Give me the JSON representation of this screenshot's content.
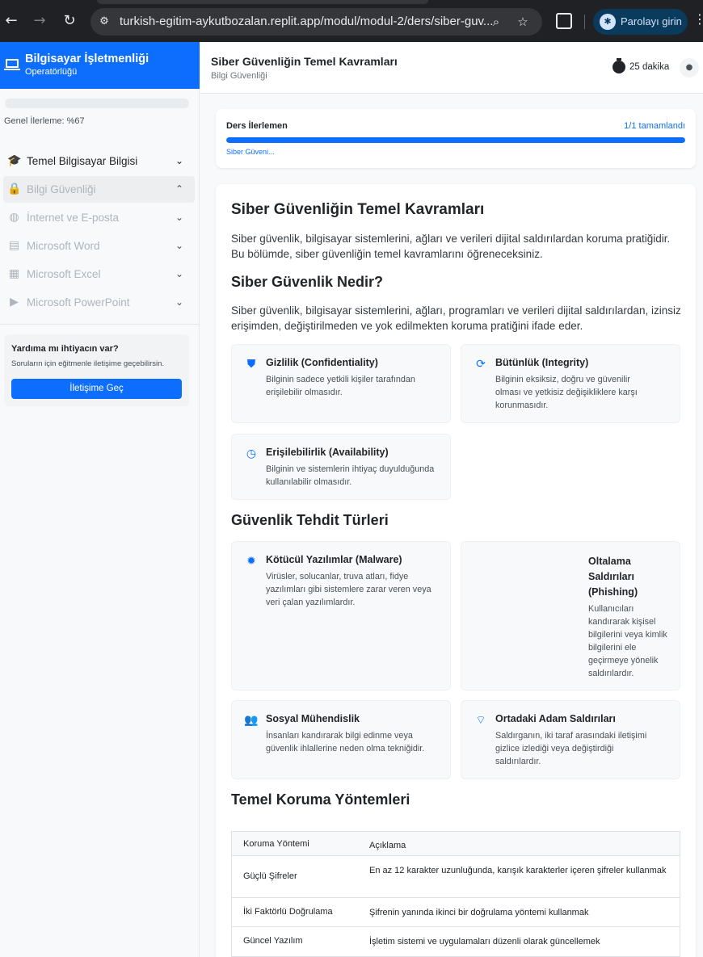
{
  "browser": {
    "url": "turkish-egitim-aykutbozalan.replit.app/modul/modul-2/ders/siber-guv...",
    "password_button": "Parolayı girin"
  },
  "sidebar": {
    "brand_title": "Bilgisayar İşletmenliği",
    "brand_subtitle": "Operatörlüğü",
    "progress_text": "Genel İlerleme: %67",
    "modules": [
      {
        "label": "Temel Bilgisayar Bilgisi",
        "icon": "graduation-cap-icon",
        "state": "active"
      },
      {
        "label": "Bilgi Güvenliği",
        "icon": "lock-icon",
        "state": "locked-expanded"
      },
      {
        "label": "İnternet ve E-posta",
        "icon": "globe-icon",
        "state": "locked"
      },
      {
        "label": "Microsoft Word",
        "icon": "document-icon",
        "state": "locked"
      },
      {
        "label": "Microsoft Excel",
        "icon": "table-icon",
        "state": "locked"
      },
      {
        "label": "Microsoft PowerPoint",
        "icon": "slideshow-icon",
        "state": "locked"
      }
    ],
    "help": {
      "title": "Yardıma mı ihtiyacın var?",
      "text": "Soruların için eğitmenle iletişime geçebilirsin.",
      "button": "İletişime Geç"
    }
  },
  "header": {
    "title": "Siber Güvenliğin Temel Kavramları",
    "subtitle": "Bilgi Güvenliği",
    "duration": "25 dakika"
  },
  "lesson_progress": {
    "label": "Ders İlerlemen",
    "count": "1/1 tamamlandı",
    "fraction": 1.0,
    "lesson_link": "Siber Güveni..."
  },
  "content": {
    "h1": "Siber Güvenliğin Temel Kavramları",
    "intro": "Siber güvenlik, bilgisayar sistemlerini, ağları ve verileri dijital saldırılardan koruma pratiğidir. Bu bölümde, siber güvenliğin temel kavramlarını öğreneceksiniz.",
    "h2_what": "Siber Güvenlik Nedir?",
    "what_text": "Siber güvenlik, bilgisayar sistemlerini, ağları, programları ve verileri dijital saldırılardan, izinsiz erişimden, değiştirilmeden ve yok edilmekten koruma pratiğini ifade eder.",
    "principles": [
      {
        "title": "Gizlilik (Confidentiality)",
        "text": "Bilginin sadece yetkili kişiler tarafından erişilebilir olmasıdır.",
        "icon": "shield-icon"
      },
      {
        "title": "Bütünlük (Integrity)",
        "text": "Bilginin eksiksiz, doğru ve güvenilir olması ve yetkisiz değişikliklere karşı korunmasıdır.",
        "icon": "sync-icon"
      },
      {
        "title": "Erişilebilirlik (Availability)",
        "text": "Bilginin ve sistemlerin ihtiyaç duyulduğunda kullanılabilir olmasıdır.",
        "icon": "clock-icon"
      }
    ],
    "h2_threats": "Güvenlik Tehdit Türleri",
    "threats": [
      {
        "title": "Kötücül Yazılımlar (Malware)",
        "text": "Virüsler, solucanlar, truva atları, fidye yazılımları gibi sistemlere zarar veren veya veri çalan yazılımlardır.",
        "icon": "bug-icon"
      },
      {
        "title": "Oltalama Saldırıları (Phishing)",
        "text": "Kullanıcıları kandırarak kişisel bilgilerini veya kimlik bilgilerini ele geçirmeye yönelik saldırılardır.",
        "icon": "fishing-icon"
      },
      {
        "title": "Sosyal Mühendislik",
        "text": "İnsanları kandırarak bilgi edinme veya güvenlik ihlallerine neden olma tekniğidir.",
        "icon": "people-icon"
      },
      {
        "title": "Ortadaki Adam Saldırıları",
        "text": "Saldırganın, iki taraf arasındaki iletişimi gizlice izlediği veya değiştirdiği saldırılardır.",
        "icon": "wifi-off-icon"
      }
    ],
    "h2_methods": "Temel Koruma Yöntemleri",
    "table": {
      "headers": [
        "Koruma Yöntemi",
        "Açıklama"
      ],
      "rows": [
        [
          "Güçlü Şifreler",
          "En az 12 karakter uzunluğunda, karışık karakterler içeren şifreler kullanmak"
        ],
        [
          "İki Faktörlü Doğrulama",
          "Şifrenin yanında ikinci bir doğrulama yöntemi kullanmak"
        ],
        [
          "Güncel Yazılım",
          "İşletim sistemi ve uygulamaları düzenli olarak güncellemek"
        ]
      ]
    }
  },
  "colors": {
    "accent": "#0d6efd",
    "chrome": "#202124"
  }
}
